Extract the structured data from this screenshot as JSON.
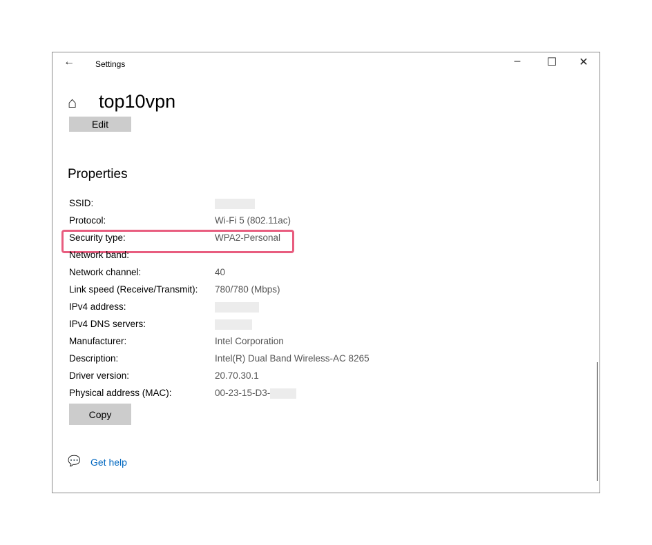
{
  "window": {
    "title": "Settings",
    "back_icon": "arrow-left-icon",
    "controls": {
      "minimize": "–",
      "maximize": "☐",
      "close": "✕"
    }
  },
  "header": {
    "title": "top10vpn",
    "home_icon": "home-icon"
  },
  "edit_label": "Edit",
  "properties": {
    "heading": "Properties",
    "rows": [
      {
        "label": "SSID:",
        "value": ""
      },
      {
        "label": "Protocol:",
        "value": "Wi-Fi 5 (802.11ac)"
      },
      {
        "label": "Security type:",
        "value": "WPA2-Personal"
      },
      {
        "label": "Network band:",
        "value": ""
      },
      {
        "label": "Network channel:",
        "value": "40"
      },
      {
        "label": "Link speed (Receive/Transmit):",
        "value": "780/780 (Mbps)"
      },
      {
        "label": "IPv4 address:",
        "value": ""
      },
      {
        "label": "IPv4 DNS servers:",
        "value": ""
      },
      {
        "label": "Manufacturer:",
        "value": "Intel Corporation"
      },
      {
        "label": "Description:",
        "value": "Intel(R) Dual Band Wireless-AC 8265"
      },
      {
        "label": "Driver version:",
        "value": "20.70.30.1"
      },
      {
        "label": "Physical address (MAC):",
        "value": "00-23-15-D3-"
      }
    ],
    "copy_label": "Copy"
  },
  "help": {
    "label": "Get help",
    "icon": "chat-help-icon"
  },
  "highlight_color": "#e85d7f"
}
